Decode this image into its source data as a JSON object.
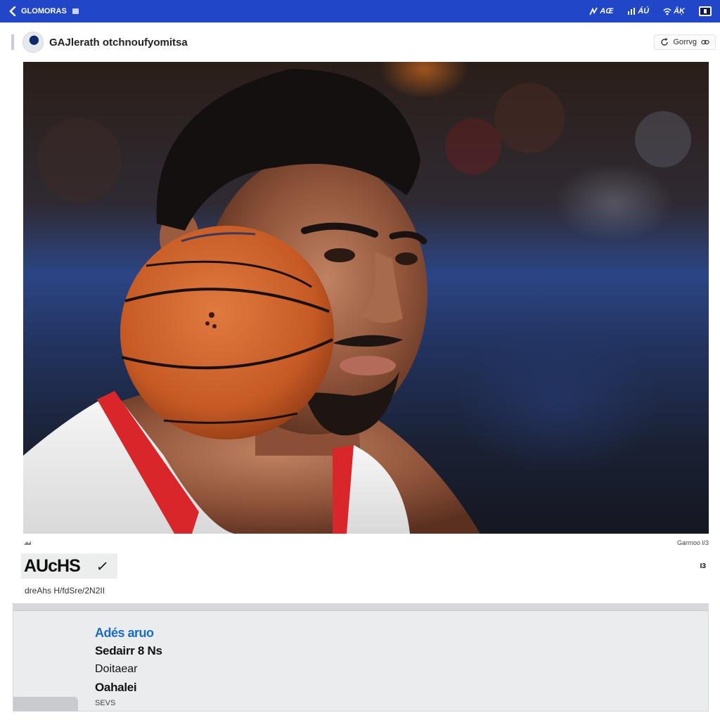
{
  "topbar": {
    "back_label": "GLOMORAS",
    "icons": [
      {
        "name": "signal-icon",
        "label": "AŒ"
      },
      {
        "name": "network-icon",
        "label": "ÁÚ"
      },
      {
        "name": "wifi-icon",
        "label": "ĀĶ"
      },
      {
        "name": "battery-icon",
        "label": ""
      }
    ],
    "accent": "#2146c7"
  },
  "header": {
    "title": "GAJlerath otchnoufyomitsa",
    "share_label": "Gorrvg"
  },
  "photo": {
    "description_icon": "basketball-player-photo"
  },
  "credit": {
    "left": "",
    "right": "Garrnoo l/3"
  },
  "name_block": {
    "name": "AUcHS",
    "pager": "I3"
  },
  "subtitle": "dreAhs H/fdSre/2N2II",
  "panel": {
    "link": "Adés aruo",
    "line2": "Sedairr 8 Ns",
    "line3": "Doitaear",
    "line4": "Oahalei",
    "line5": "SEVS"
  }
}
